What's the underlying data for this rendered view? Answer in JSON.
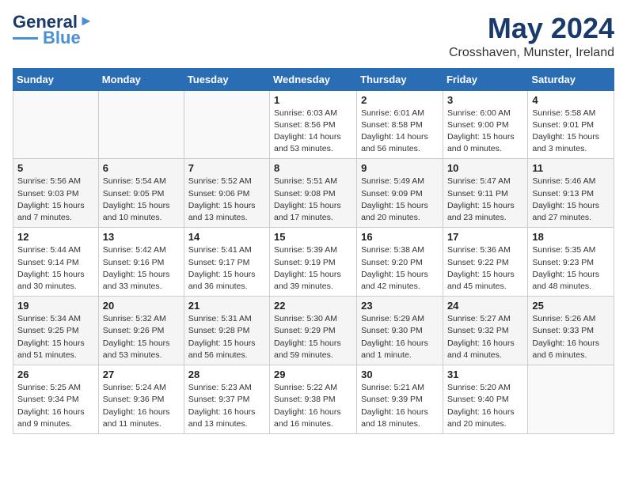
{
  "header": {
    "logo_line1": "General",
    "logo_line2": "Blue",
    "main_title": "May 2024",
    "subtitle": "Crosshaven, Munster, Ireland"
  },
  "days_of_week": [
    "Sunday",
    "Monday",
    "Tuesday",
    "Wednesday",
    "Thursday",
    "Friday",
    "Saturday"
  ],
  "weeks": [
    [
      {
        "num": "",
        "info": ""
      },
      {
        "num": "",
        "info": ""
      },
      {
        "num": "",
        "info": ""
      },
      {
        "num": "1",
        "info": "Sunrise: 6:03 AM\nSunset: 8:56 PM\nDaylight: 14 hours\nand 53 minutes."
      },
      {
        "num": "2",
        "info": "Sunrise: 6:01 AM\nSunset: 8:58 PM\nDaylight: 14 hours\nand 56 minutes."
      },
      {
        "num": "3",
        "info": "Sunrise: 6:00 AM\nSunset: 9:00 PM\nDaylight: 15 hours\nand 0 minutes."
      },
      {
        "num": "4",
        "info": "Sunrise: 5:58 AM\nSunset: 9:01 PM\nDaylight: 15 hours\nand 3 minutes."
      }
    ],
    [
      {
        "num": "5",
        "info": "Sunrise: 5:56 AM\nSunset: 9:03 PM\nDaylight: 15 hours\nand 7 minutes."
      },
      {
        "num": "6",
        "info": "Sunrise: 5:54 AM\nSunset: 9:05 PM\nDaylight: 15 hours\nand 10 minutes."
      },
      {
        "num": "7",
        "info": "Sunrise: 5:52 AM\nSunset: 9:06 PM\nDaylight: 15 hours\nand 13 minutes."
      },
      {
        "num": "8",
        "info": "Sunrise: 5:51 AM\nSunset: 9:08 PM\nDaylight: 15 hours\nand 17 minutes."
      },
      {
        "num": "9",
        "info": "Sunrise: 5:49 AM\nSunset: 9:09 PM\nDaylight: 15 hours\nand 20 minutes."
      },
      {
        "num": "10",
        "info": "Sunrise: 5:47 AM\nSunset: 9:11 PM\nDaylight: 15 hours\nand 23 minutes."
      },
      {
        "num": "11",
        "info": "Sunrise: 5:46 AM\nSunset: 9:13 PM\nDaylight: 15 hours\nand 27 minutes."
      }
    ],
    [
      {
        "num": "12",
        "info": "Sunrise: 5:44 AM\nSunset: 9:14 PM\nDaylight: 15 hours\nand 30 minutes."
      },
      {
        "num": "13",
        "info": "Sunrise: 5:42 AM\nSunset: 9:16 PM\nDaylight: 15 hours\nand 33 minutes."
      },
      {
        "num": "14",
        "info": "Sunrise: 5:41 AM\nSunset: 9:17 PM\nDaylight: 15 hours\nand 36 minutes."
      },
      {
        "num": "15",
        "info": "Sunrise: 5:39 AM\nSunset: 9:19 PM\nDaylight: 15 hours\nand 39 minutes."
      },
      {
        "num": "16",
        "info": "Sunrise: 5:38 AM\nSunset: 9:20 PM\nDaylight: 15 hours\nand 42 minutes."
      },
      {
        "num": "17",
        "info": "Sunrise: 5:36 AM\nSunset: 9:22 PM\nDaylight: 15 hours\nand 45 minutes."
      },
      {
        "num": "18",
        "info": "Sunrise: 5:35 AM\nSunset: 9:23 PM\nDaylight: 15 hours\nand 48 minutes."
      }
    ],
    [
      {
        "num": "19",
        "info": "Sunrise: 5:34 AM\nSunset: 9:25 PM\nDaylight: 15 hours\nand 51 minutes."
      },
      {
        "num": "20",
        "info": "Sunrise: 5:32 AM\nSunset: 9:26 PM\nDaylight: 15 hours\nand 53 minutes."
      },
      {
        "num": "21",
        "info": "Sunrise: 5:31 AM\nSunset: 9:28 PM\nDaylight: 15 hours\nand 56 minutes."
      },
      {
        "num": "22",
        "info": "Sunrise: 5:30 AM\nSunset: 9:29 PM\nDaylight: 15 hours\nand 59 minutes."
      },
      {
        "num": "23",
        "info": "Sunrise: 5:29 AM\nSunset: 9:30 PM\nDaylight: 16 hours\nand 1 minute."
      },
      {
        "num": "24",
        "info": "Sunrise: 5:27 AM\nSunset: 9:32 PM\nDaylight: 16 hours\nand 4 minutes."
      },
      {
        "num": "25",
        "info": "Sunrise: 5:26 AM\nSunset: 9:33 PM\nDaylight: 16 hours\nand 6 minutes."
      }
    ],
    [
      {
        "num": "26",
        "info": "Sunrise: 5:25 AM\nSunset: 9:34 PM\nDaylight: 16 hours\nand 9 minutes."
      },
      {
        "num": "27",
        "info": "Sunrise: 5:24 AM\nSunset: 9:36 PM\nDaylight: 16 hours\nand 11 minutes."
      },
      {
        "num": "28",
        "info": "Sunrise: 5:23 AM\nSunset: 9:37 PM\nDaylight: 16 hours\nand 13 minutes."
      },
      {
        "num": "29",
        "info": "Sunrise: 5:22 AM\nSunset: 9:38 PM\nDaylight: 16 hours\nand 16 minutes."
      },
      {
        "num": "30",
        "info": "Sunrise: 5:21 AM\nSunset: 9:39 PM\nDaylight: 16 hours\nand 18 minutes."
      },
      {
        "num": "31",
        "info": "Sunrise: 5:20 AM\nSunset: 9:40 PM\nDaylight: 16 hours\nand 20 minutes."
      },
      {
        "num": "",
        "info": ""
      }
    ]
  ]
}
